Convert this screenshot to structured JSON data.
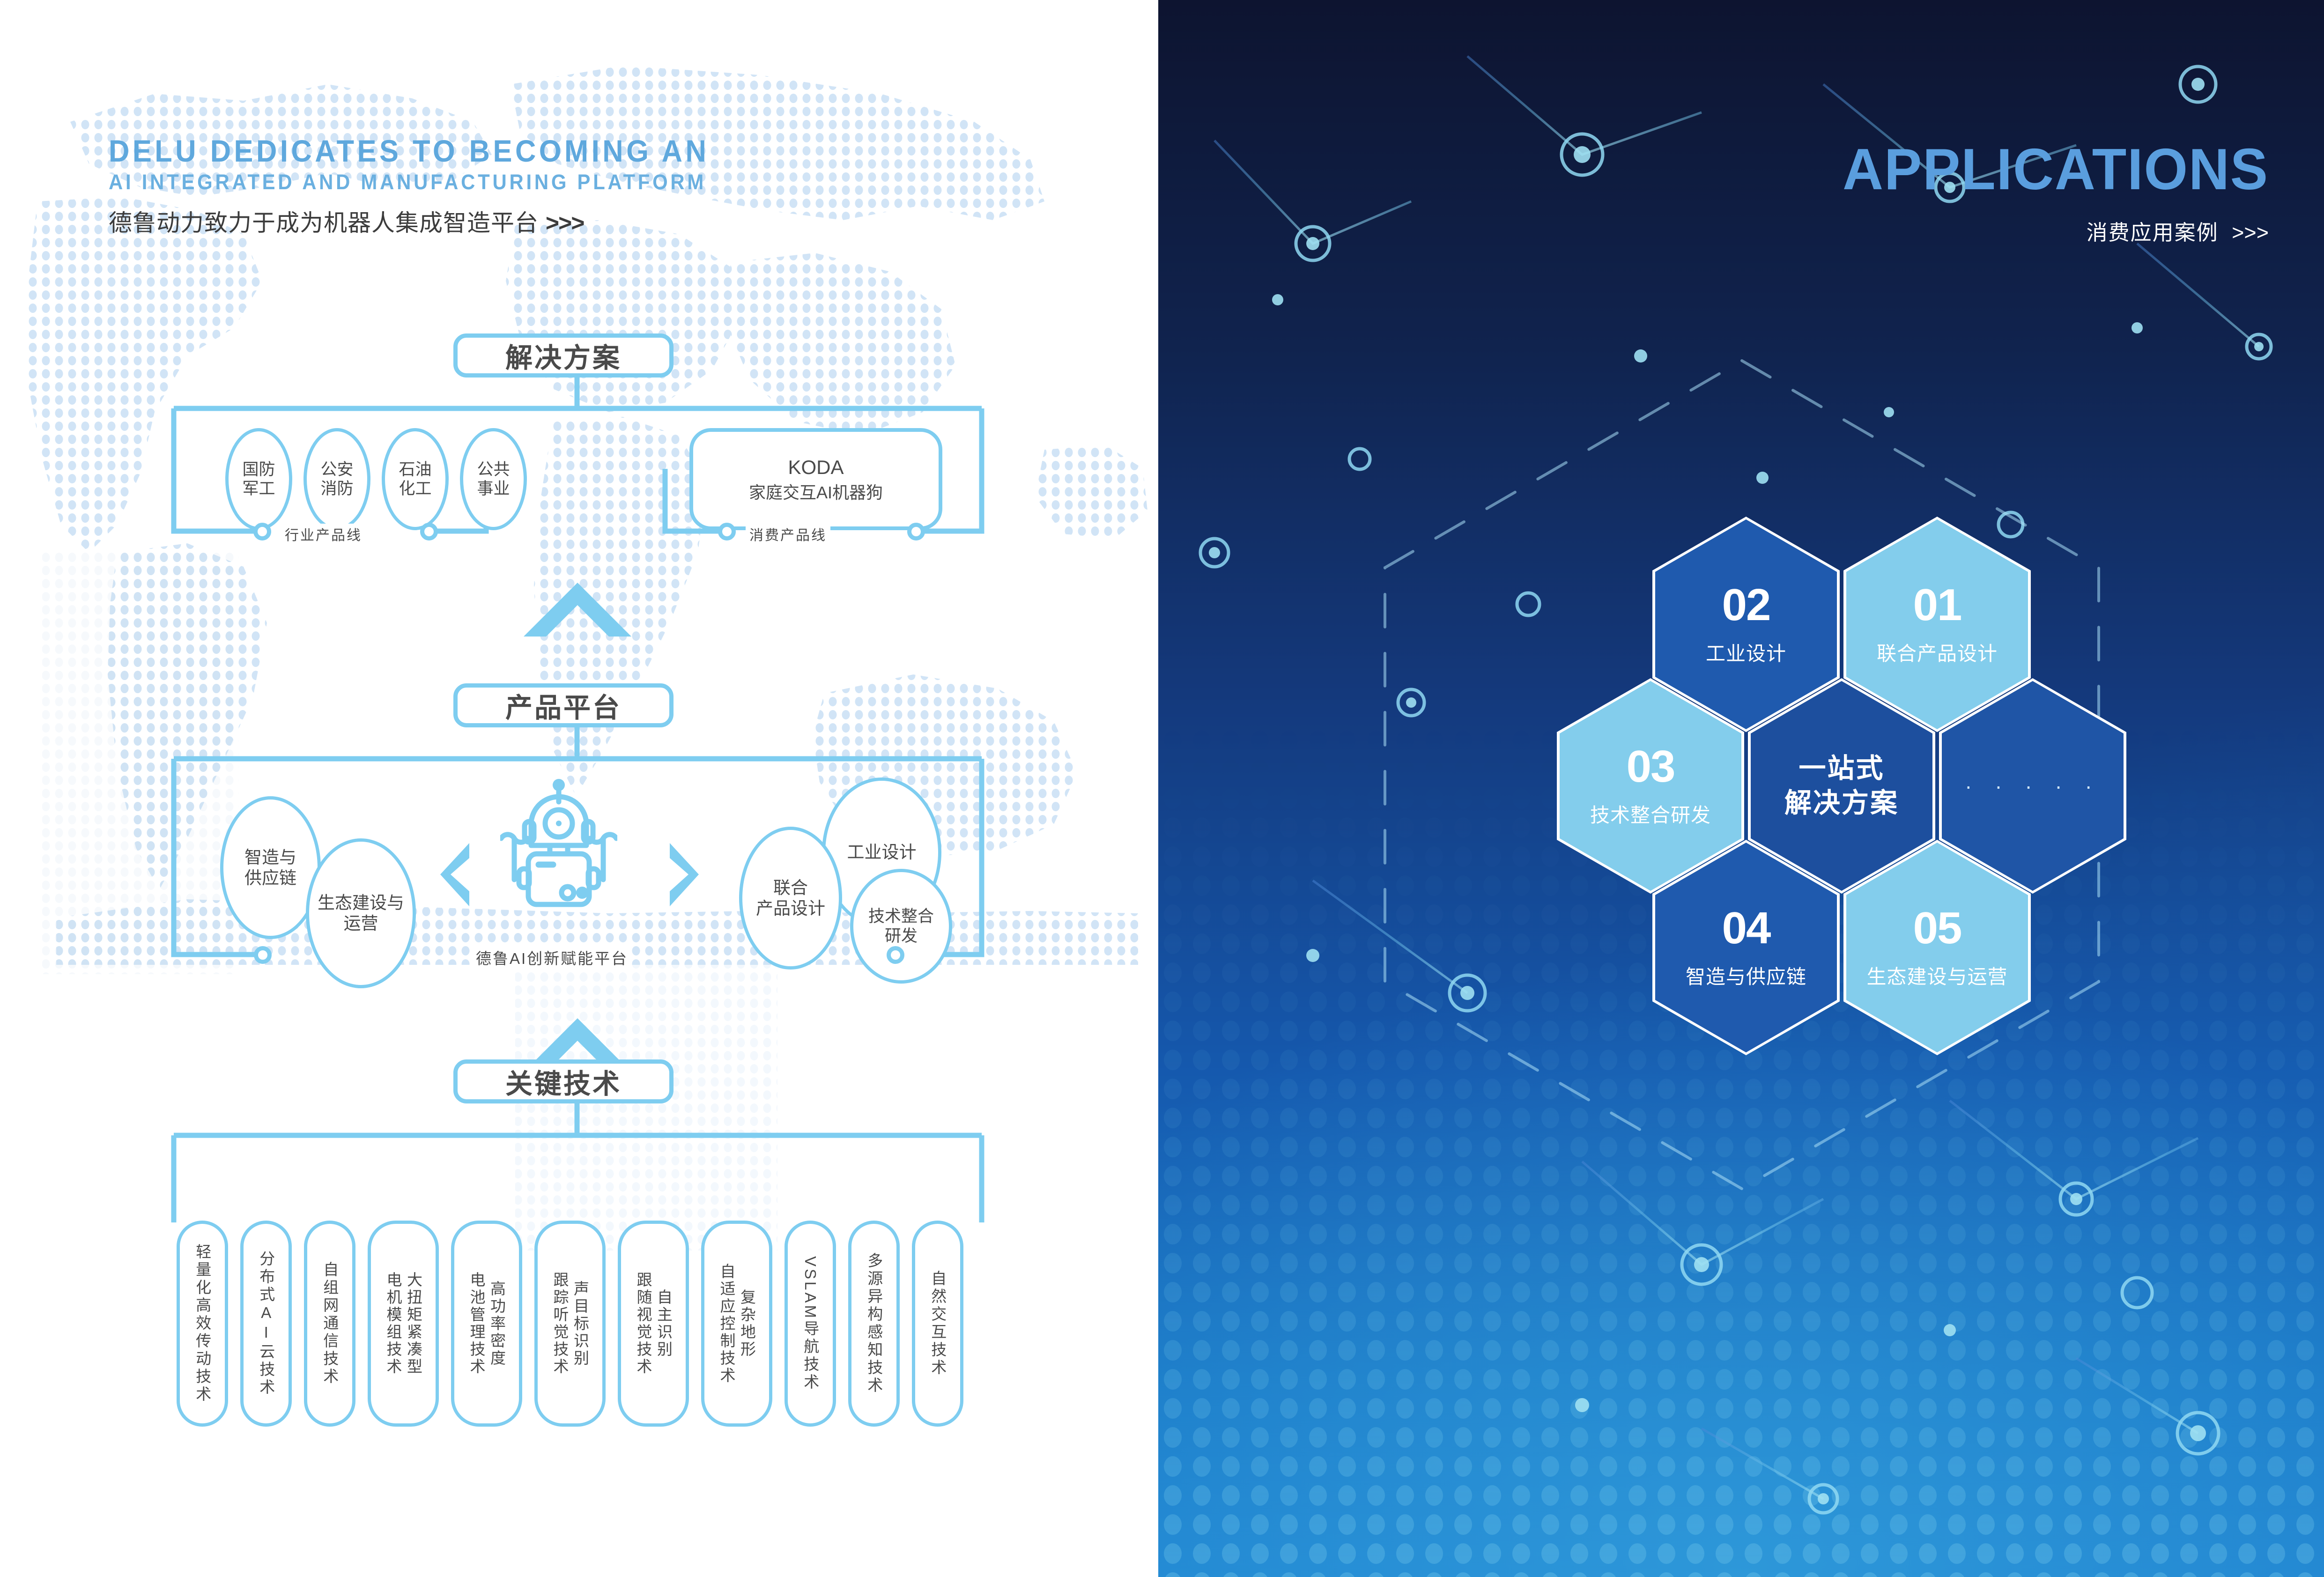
{
  "left": {
    "header": {
      "en_line1": "DELU DEDICATES TO BECOMING AN",
      "en_line2": "AI INTEGRATED AND MANUFACTURING PLATFORM",
      "cn": "德鲁动力致力于成为机器人集成智造平台",
      "arrows": ">>>"
    },
    "solution": {
      "title": "解决方案",
      "industry_rail_label": "行业产品线",
      "consumer_rail_label": "消费产品线",
      "industry_items": [
        {
          "l1": "国防",
          "l2": "军工"
        },
        {
          "l1": "公安",
          "l2": "消防"
        },
        {
          "l1": "石油",
          "l2": "化工"
        },
        {
          "l1": "公共",
          "l2": "事业"
        }
      ],
      "consumer_items": [
        {
          "l1": "KODA",
          "l2": "家庭交互AI机器狗"
        }
      ]
    },
    "platform": {
      "title": "产品平台",
      "rail_label": "德鲁AI创新赋能平台",
      "robot_icon": "robot-icon",
      "left_items": [
        {
          "l1": "智造与",
          "l2": "供应链"
        },
        {
          "l1": "生态建设与",
          "l2": "运营"
        }
      ],
      "right_items": [
        {
          "l1": "工业设计",
          "l2": ""
        },
        {
          "l1": "联合",
          "l2": "产品设计"
        },
        {
          "l1": "技术整合",
          "l2": "研发"
        }
      ]
    },
    "key_tech": {
      "title": "关键技术",
      "items": [
        "轻量化高效传动技术",
        "分布式AI云技术",
        "自组网通信技术",
        "大扭矩紧凑型\n电机模组技术",
        "高功率密度\n电池管理技术",
        "声目标识别\n跟踪听觉技术",
        "自主识别\n跟随视觉技术",
        "复杂地形\n自适应控制技术",
        "VSLAM导航技术",
        "多源异构感知技术",
        "自然交互技术"
      ]
    }
  },
  "right": {
    "header": {
      "title": "APPLICATIONS",
      "subtitle": "消费应用案例",
      "arrows": ">>>"
    },
    "hexagons": [
      {
        "num": "01",
        "label": "联合产品设计",
        "tone": "light"
      },
      {
        "num": "02",
        "label": "工业设计",
        "tone": "dark"
      },
      {
        "num": "03",
        "label": "技术整合研发",
        "tone": "light"
      },
      {
        "num": "04",
        "label": "智造与供应链",
        "tone": "dark"
      },
      {
        "num": "05",
        "label": "生态建设与运营",
        "tone": "light"
      }
    ],
    "center_hex": {
      "line1": "一站式",
      "line2": "解决方案"
    },
    "more_hex": {
      "dots": "· · · · ·"
    }
  },
  "colors": {
    "accent_line": "#7ecdf0",
    "accent_text": "#5fa8dd",
    "hex_light": "#83cdec",
    "hex_dark": "#1f5aae",
    "hex_center": "#1d4f9e",
    "map_dot": "#cfe3f5",
    "panel_dark_top": "#0d1430",
    "panel_bright_bottom": "#2088d4"
  }
}
